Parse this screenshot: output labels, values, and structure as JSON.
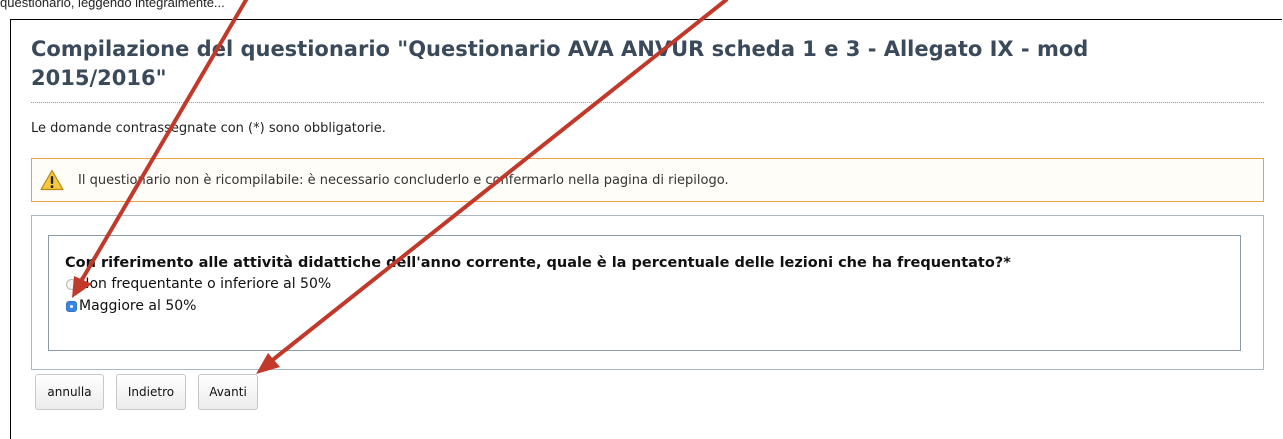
{
  "header_fragment": "questionario, leggendo integralmente...",
  "page": {
    "title": "Compilazione del questionario \"Questionario AVA ANVUR scheda 1 e 3 - Allegato IX - mod 2015/2016\"",
    "mandatory_note": "Le domande contrassegnate con (*) sono obbligatorie."
  },
  "warning": {
    "icon": "warning-triangle-icon",
    "text": "Il questionario non è ricompilabile: è necessario concluderlo e confermarlo nella pagina di riepilogo."
  },
  "question": {
    "text": "Con riferimento alle attività didattiche dell'anno corrente, quale è la percentuale delle lezioni che ha frequentato?*",
    "options": [
      {
        "label": "Non frequentante o inferiore al 50%",
        "selected": false
      },
      {
        "label": "Maggiore al 50%",
        "selected": true
      }
    ]
  },
  "buttons": {
    "cancel": "annulla",
    "back": "Indietro",
    "next": "Avanti"
  },
  "colors": {
    "title": "#3a4a5a",
    "warning_border": "#f0a040",
    "annotation_arrow": "#c0392b",
    "radio_selected": "#3a86da"
  }
}
